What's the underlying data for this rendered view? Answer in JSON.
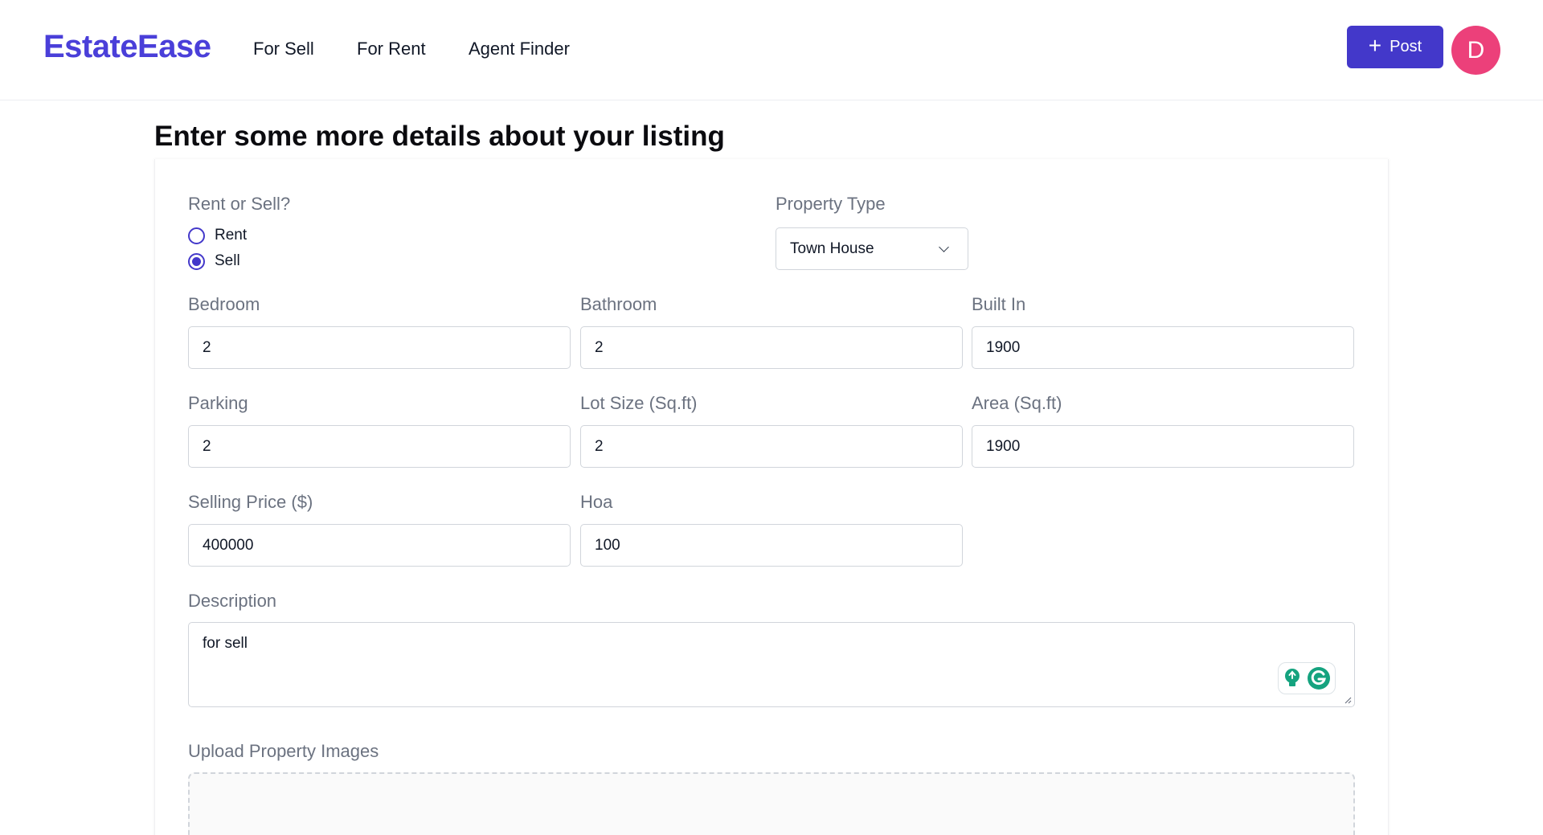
{
  "header": {
    "logo": "EstateEase",
    "nav": [
      "For Sell",
      "For Rent",
      "Agent Finder"
    ],
    "post_label": "Post",
    "avatar_initial": "D"
  },
  "page": {
    "title": "Enter some more details about your listing"
  },
  "form": {
    "rent_or_sell": {
      "label": "Rent or Sell?",
      "options": [
        "Rent",
        "Sell"
      ],
      "selected": "Sell"
    },
    "property_type": {
      "label": "Property Type",
      "value": "Town House"
    },
    "bedroom": {
      "label": "Bedroom",
      "value": "2"
    },
    "bathroom": {
      "label": "Bathroom",
      "value": "2"
    },
    "built_in": {
      "label": "Built In",
      "value": "1900"
    },
    "parking": {
      "label": "Parking",
      "value": "2"
    },
    "lot_size": {
      "label": "Lot Size (Sq.ft)",
      "value": "2"
    },
    "area": {
      "label": "Area (Sq.ft)",
      "value": "1900"
    },
    "selling_price": {
      "label": "Selling Price ($)",
      "value": "400000"
    },
    "hoa": {
      "label": "Hoa",
      "value": "100"
    },
    "description": {
      "label": "Description",
      "value": "for sell"
    },
    "upload": {
      "label": "Upload Property Images"
    }
  },
  "colors": {
    "brand": "#4a3fd9",
    "primary": "#4338ca",
    "avatar": "#ec407a",
    "grammarly": "#15a37f"
  }
}
